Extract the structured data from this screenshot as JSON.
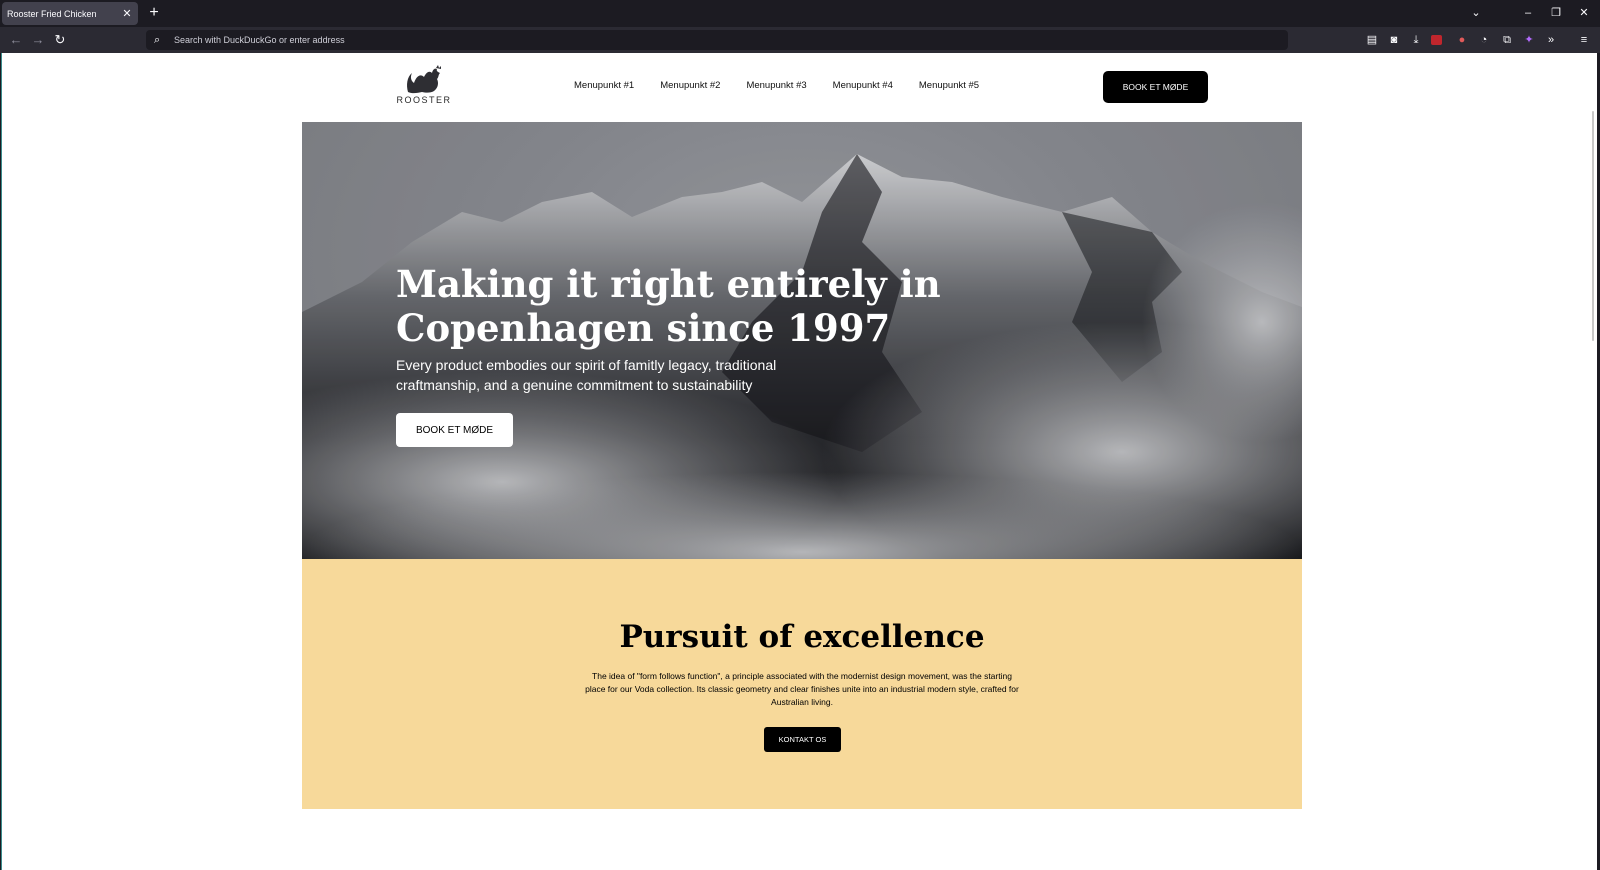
{
  "browser": {
    "tab_title": "Rooster Fried Chicken",
    "tab_close": "✕",
    "new_tab": "+",
    "address_placeholder": "Search with DuckDuckGo or enter address"
  },
  "site": {
    "logo_text": "ROOSTER",
    "menu": [
      "Menupunkt #1",
      "Menupunkt #2",
      "Menupunkt #3",
      "Menupunkt #4",
      "Menupunkt #5"
    ],
    "header_cta": "BOOK ET MØDE"
  },
  "hero": {
    "title": "Making it right entirely in Copenhagen since 1997",
    "subtitle": "Every product embodies our spirit of famitly legacy, traditional craftmanship, and a genuine commitment to sustainability",
    "cta": "BOOK ET MØDE"
  },
  "excellence": {
    "title": "Pursuit of excellence",
    "body": "The idea of \"form follows function\", a principle associated with the modernist design movement, was the starting place for our Voda collection. Its classic geometry and clear finishes unite into an industrial modern style, crafted for Australian living.",
    "cta": "KONTAKT OS"
  },
  "colors": {
    "section_bg": "#f7d99a",
    "cta_dark": "#000000"
  }
}
